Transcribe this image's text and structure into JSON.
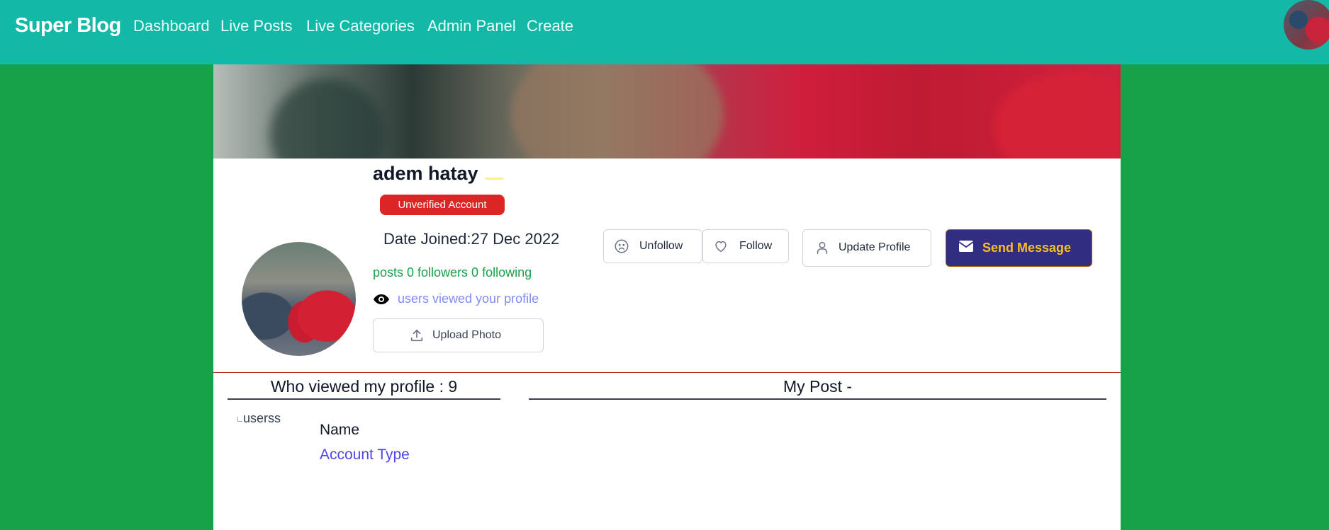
{
  "navbar": {
    "brand": "Super Blog",
    "links": [
      "Dashboard",
      "Live Posts",
      "Live Categories",
      "Admin Panel",
      "Create"
    ],
    "bg_color": "#14b8a6"
  },
  "profile": {
    "name": "adem hatay",
    "badge": "Unverified Account",
    "date_joined": "Date Joined:27 Dec 2022",
    "stats": "posts 0 followers 0 following",
    "viewed_text": "users viewed your profile",
    "upload_label": "Upload Photo"
  },
  "actions": {
    "unfollow": "Unfollow",
    "follow": "Follow",
    "update": "Update Profile",
    "send": "Send Message"
  },
  "sections": {
    "viewed_heading": "Who viewed my profile : 9",
    "post_heading": "My Post -"
  },
  "viewers": [
    {
      "img_alt": "userss",
      "name": "Name",
      "account_type": "Account Type"
    }
  ],
  "icons": {
    "eye": "eye-icon",
    "upload": "upload-icon",
    "unfollow": "sad-face-icon",
    "follow": "heart-icon",
    "update": "user-icon",
    "send": "envelope-icon"
  },
  "colors": {
    "page_bg": "#16a249",
    "badge": "#dc2626",
    "send_button": "#312e81",
    "send_label": "#fbbf24",
    "stats_text": "#16a34a",
    "viewed_text": "#818cf8",
    "account_type": "#4f46e5"
  }
}
